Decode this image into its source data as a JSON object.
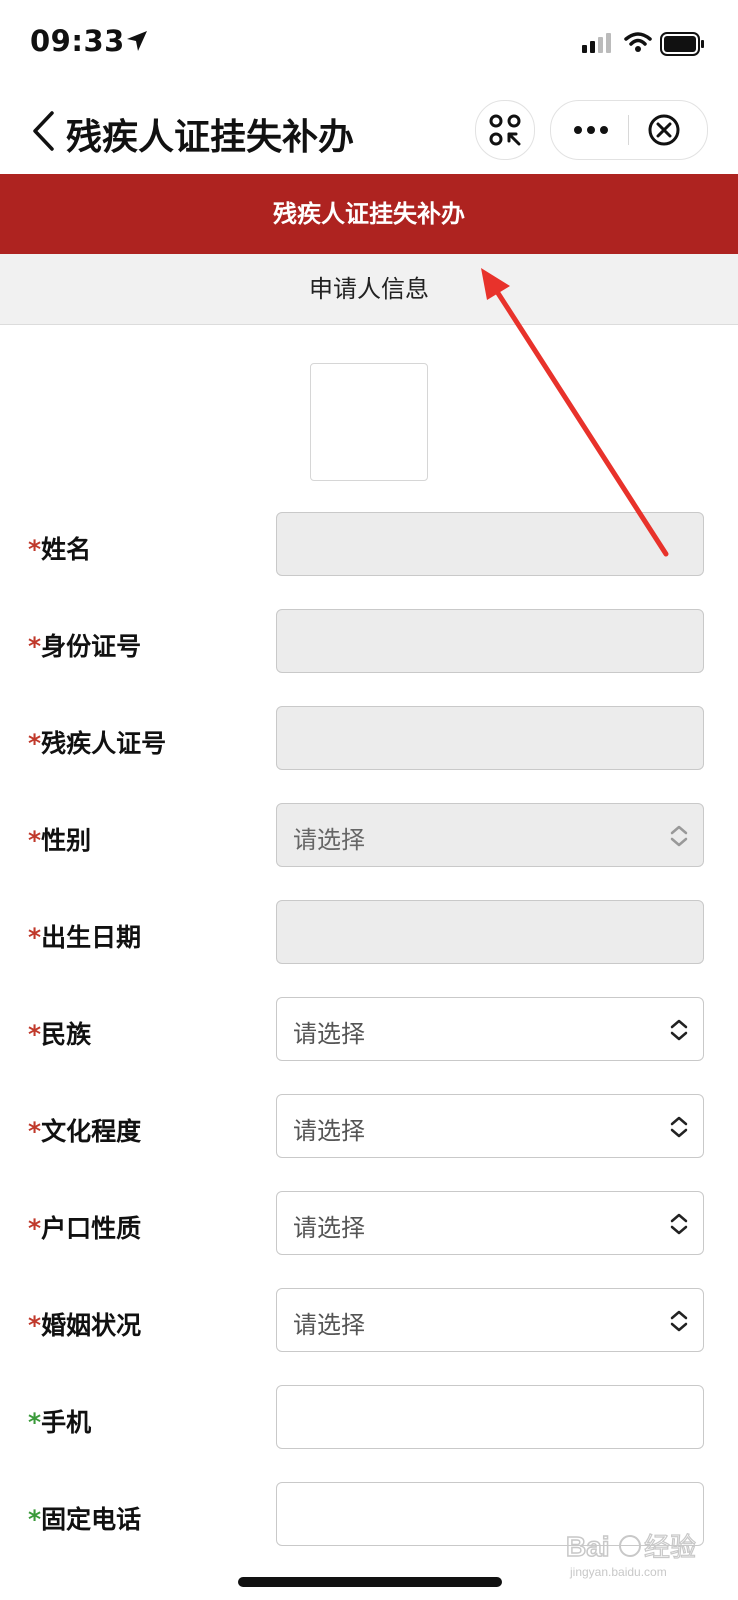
{
  "status_bar": {
    "time": "09:33"
  },
  "nav": {
    "title": "残疾人证挂失补办"
  },
  "banner": {
    "title": "残疾人证挂失补办"
  },
  "section": {
    "title": "申请人信息"
  },
  "form": {
    "rows": [
      {
        "required_mark": "*",
        "label": "姓名",
        "value": "",
        "type": "text",
        "disabled": true
      },
      {
        "required_mark": "*",
        "label": "身份证号",
        "value": "",
        "type": "text",
        "disabled": true
      },
      {
        "required_mark": "*",
        "label": "残疾人证号",
        "value": "",
        "type": "text",
        "disabled": true
      },
      {
        "required_mark": "*",
        "label": "性别",
        "value": "请选择",
        "type": "select",
        "disabled": true
      },
      {
        "required_mark": "*",
        "label": "出生日期",
        "value": "",
        "type": "text",
        "disabled": true
      },
      {
        "required_mark": "*",
        "label": "民族",
        "value": "请选择",
        "type": "select",
        "disabled": false
      },
      {
        "required_mark": "*",
        "label": "文化程度",
        "value": "请选择",
        "type": "select",
        "disabled": false
      },
      {
        "required_mark": "*",
        "label": "户口性质",
        "value": "请选择",
        "type": "select",
        "disabled": false
      },
      {
        "required_mark": "*",
        "label": "婚姻状况",
        "value": "请选择",
        "type": "select",
        "disabled": false
      },
      {
        "required_mark": "*",
        "label": "手机",
        "value": "",
        "type": "text",
        "disabled": false
      },
      {
        "required_mark": "*",
        "label": "固定电话",
        "value": "",
        "type": "text",
        "disabled": false
      }
    ]
  },
  "watermark": {
    "text": "Bai 经验",
    "subtext": "jingyan.baidu.com"
  },
  "colors": {
    "banner": "#ae2320",
    "required_red": "#c0392b",
    "required_green": "#3a9a3a",
    "arrow": "#e8322b"
  },
  "icons": [
    "location-arrow-icon",
    "signal-icon",
    "wifi-icon",
    "battery-icon",
    "back-icon",
    "scan-icon",
    "more-icon",
    "close-icon",
    "updown-icon"
  ]
}
